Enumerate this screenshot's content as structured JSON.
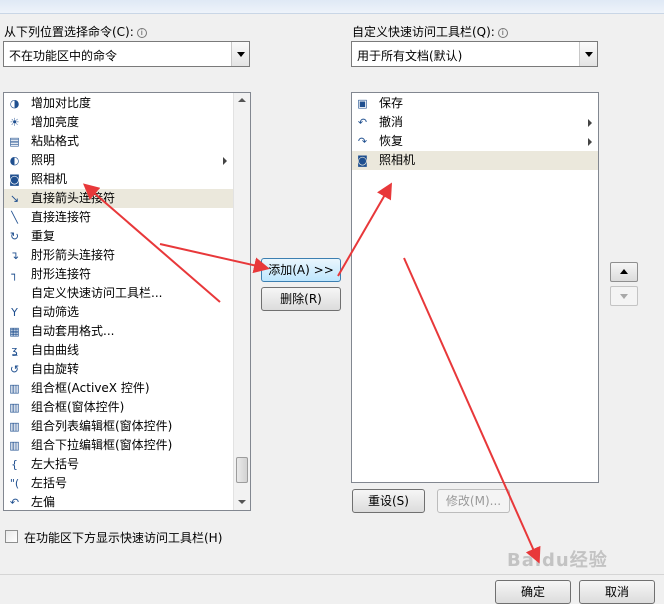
{
  "left_panel": {
    "label": "从下列位置选择命令(C):",
    "combo_value": "不在功能区中的命令",
    "commands": [
      {
        "icon": "contrast-icon",
        "glyph": "◑",
        "label": "增加对比度"
      },
      {
        "icon": "brightness-icon",
        "glyph": "☀",
        "label": "增加亮度"
      },
      {
        "icon": "paste-format-icon",
        "glyph": "▤",
        "label": "粘贴格式"
      },
      {
        "icon": "lighting-icon",
        "glyph": "◐",
        "label": "照明",
        "submenu": true
      },
      {
        "icon": "camera-icon",
        "glyph": "◙",
        "label": "照相机"
      },
      {
        "icon": "arrow-connector-icon",
        "glyph": "↘",
        "label": "直接箭头连接符",
        "selected": true
      },
      {
        "icon": "straight-connector-icon",
        "glyph": "╲",
        "label": "直接连接符"
      },
      {
        "icon": "repeat-icon",
        "glyph": "↻",
        "label": "重复"
      },
      {
        "icon": "elbow-arrow-connector-icon",
        "glyph": "↴",
        "label": "肘形箭头连接符"
      },
      {
        "icon": "elbow-connector-icon",
        "glyph": "┐",
        "label": "肘形连接符"
      },
      {
        "icon": "blank-icon",
        "glyph": "",
        "label": "自定义快速访问工具栏..."
      },
      {
        "icon": "autofilter-icon",
        "glyph": "Y",
        "label": "自动筛选"
      },
      {
        "icon": "autoformat-icon",
        "glyph": "▦",
        "label": "自动套用格式..."
      },
      {
        "icon": "freeform-icon",
        "glyph": "ʓ",
        "label": "自由曲线"
      },
      {
        "icon": "free-rotate-icon",
        "glyph": "↺",
        "label": "自由旋转"
      },
      {
        "icon": "combobox-activex-icon",
        "glyph": "▥",
        "label": "组合框(ActiveX 控件)"
      },
      {
        "icon": "combobox-form-icon",
        "glyph": "▥",
        "label": "组合框(窗体控件)"
      },
      {
        "icon": "list-edit-combobox-icon",
        "glyph": "▥",
        "label": "组合列表编辑框(窗体控件)"
      },
      {
        "icon": "dropdown-edit-combobox-icon",
        "glyph": "▥",
        "label": "组合下拉编辑框(窗体控件)"
      },
      {
        "icon": "left-brace-icon",
        "glyph": "{",
        "label": "左大括号"
      },
      {
        "icon": "left-paren-icon",
        "glyph": "\"(",
        "label": "左括号"
      },
      {
        "icon": "left-offset-icon",
        "glyph": "↶",
        "label": "左偏"
      }
    ]
  },
  "right_panel": {
    "label": "自定义快速访问工具栏(Q):",
    "combo_value": "用于所有文档(默认)",
    "items": [
      {
        "icon": "save-icon",
        "glyph": "▣",
        "label": "保存"
      },
      {
        "icon": "undo-icon",
        "glyph": "↶",
        "label": "撤消",
        "submenu": true
      },
      {
        "icon": "redo-icon",
        "glyph": "↷",
        "label": "恢复",
        "submenu": true
      },
      {
        "icon": "camera-icon",
        "glyph": "◙",
        "label": "照相机",
        "selected": true
      }
    ]
  },
  "buttons": {
    "add": "添加(A) >>",
    "remove": "删除(R)",
    "reset": "重设(S)",
    "modify": "修改(M)...",
    "ok": "确定",
    "cancel": "取消"
  },
  "checkbox_label": "在功能区下方显示快速访问工具栏(H)",
  "watermark": "Baidu经验",
  "colors": {
    "annotation": "#e8383a",
    "selection": "#ebe8dc"
  }
}
